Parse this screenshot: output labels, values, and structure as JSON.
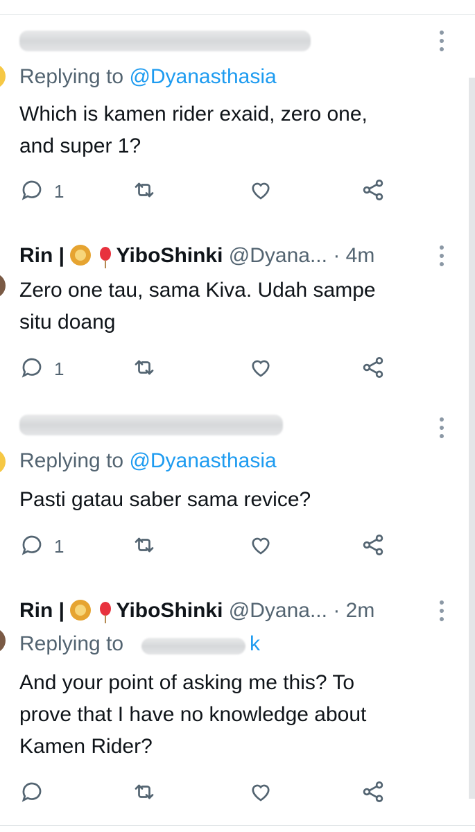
{
  "tweets": [
    {
      "reply_prefix": "Replying to",
      "reply_to": "@Dyanasthasia",
      "text_lines": [
        "Which is kamen rider exaid, zero one,",
        "and super 1?"
      ],
      "reply_count": "1"
    },
    {
      "name_prefix": "Rin |",
      "name_suffix": "YiboShinki",
      "handle": "@Dyana...",
      "dot": "·",
      "time": "4m",
      "text_lines": [
        "Zero one tau, sama Kiva. Udah sampe",
        "situ doang"
      ],
      "reply_count": "1"
    },
    {
      "reply_prefix": "Replying to",
      "reply_to": "@Dyanasthasia",
      "text_lines": [
        "Pasti gatau saber sama revice?"
      ],
      "reply_count": "1"
    },
    {
      "name_prefix": "Rin |",
      "name_suffix": "YiboShinki",
      "handle": "@Dyana...",
      "dot": "·",
      "time": "2m",
      "reply_prefix": "Replying to",
      "reply_to_visible": "k",
      "text_lines": [
        "And your point of asking me this? To",
        "prove that I have no knowledge  about",
        "Kamen Rider?"
      ],
      "reply_count": ""
    }
  ],
  "icons": {
    "reply": "reply-icon",
    "retweet": "retweet-icon",
    "like": "like-icon",
    "share": "share-icon",
    "more": "more-icon"
  },
  "colors": {
    "text": "#0f1419",
    "secondary": "#536471",
    "link": "#1d9bf0",
    "avatar_yellow": "#f6c845"
  }
}
